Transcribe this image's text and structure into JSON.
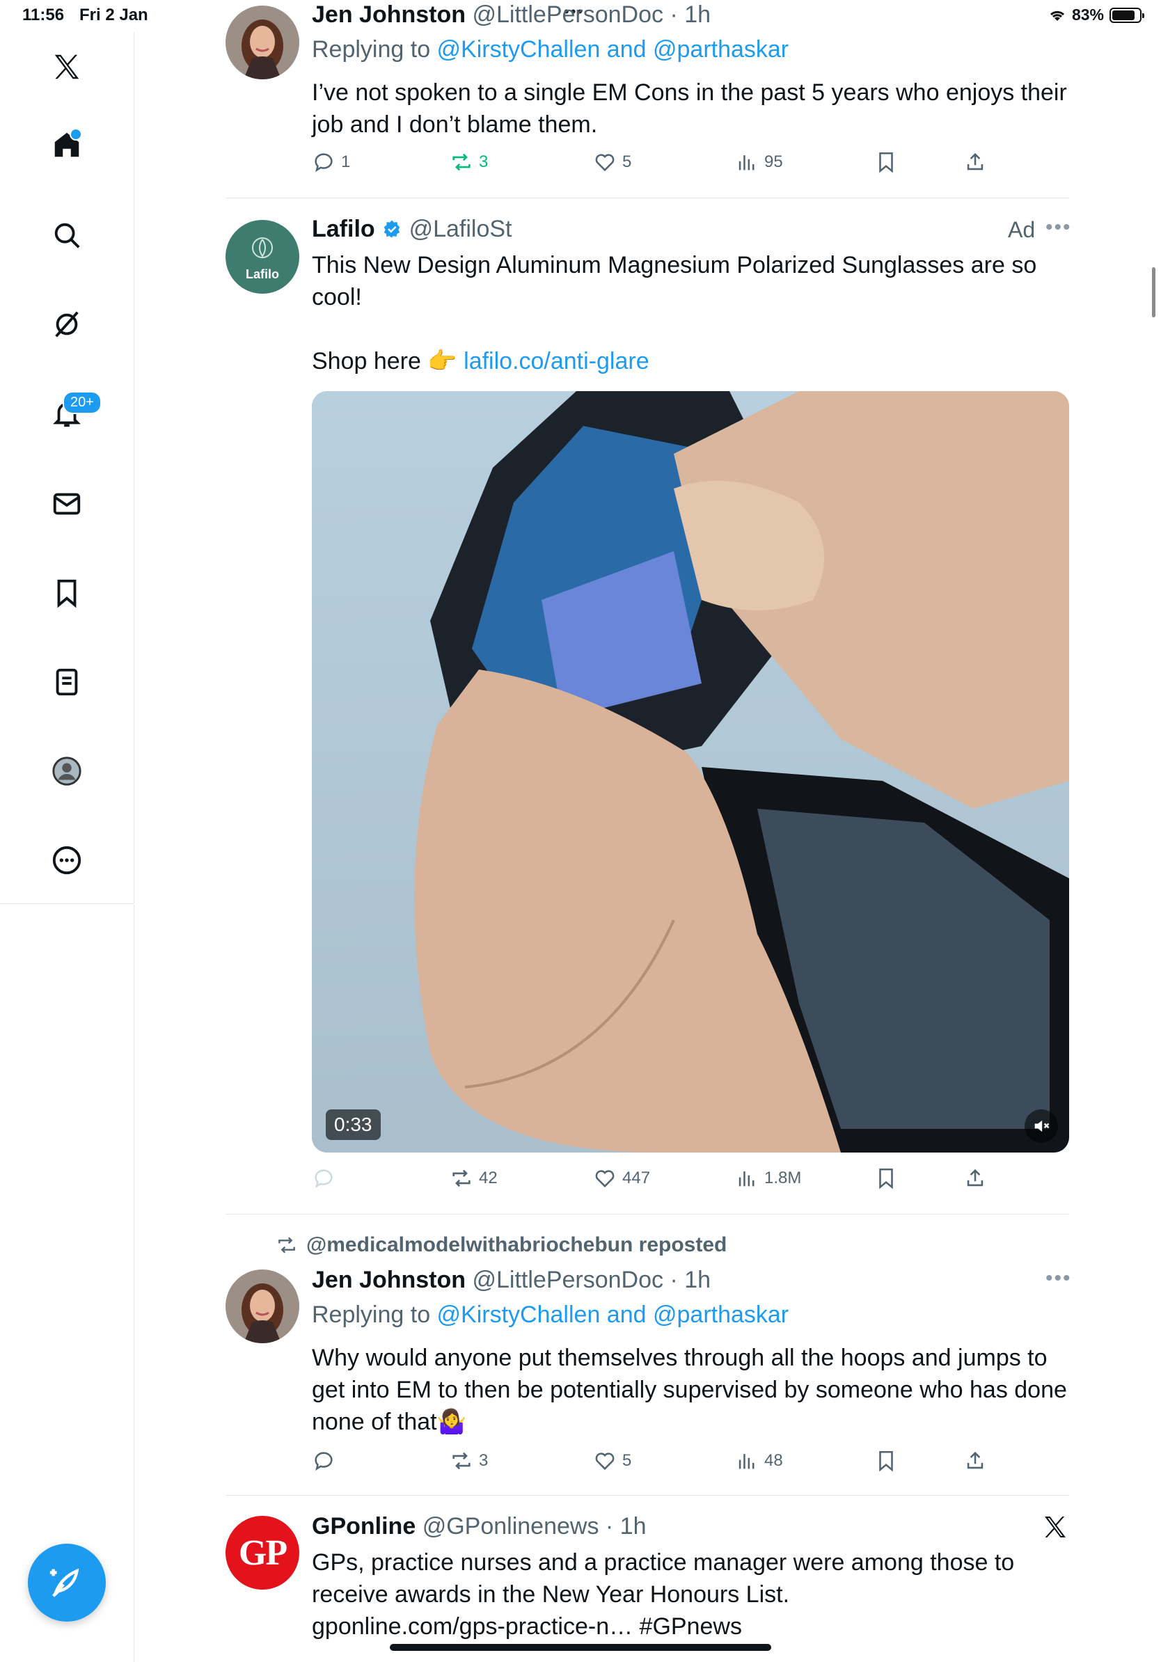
{
  "status_bar": {
    "time": "11:56",
    "date": "Fri 2 Jan",
    "battery": "83%",
    "battery_level": 0.83
  },
  "sidebar": {
    "items": [
      {
        "icon": "x-logo-icon"
      },
      {
        "icon": "home-icon"
      },
      {
        "icon": "search-icon"
      },
      {
        "icon": "grok-icon"
      },
      {
        "icon": "bell-icon",
        "badge": "20+"
      },
      {
        "icon": "mail-icon"
      },
      {
        "icon": "bookmark-icon"
      },
      {
        "icon": "list-icon"
      },
      {
        "icon": "profile-icon"
      },
      {
        "icon": "more-circle-icon"
      }
    ],
    "accent": "#1d9bf0"
  },
  "tweets": [
    {
      "name": "Jen Johnston",
      "handle": "@LittlePersonDoc",
      "time": "· 1h",
      "replying_prefix": "Replying to ",
      "replying_to": "@KirstyChallen and @parthaskar",
      "text": "I’ve not spoken to a single EM Cons in the past 5 years who enjoys their job and I don’t blame them.",
      "replies": "1",
      "reposts": "3",
      "likes": "5",
      "views": "95"
    },
    {
      "name": "Lafilo",
      "handle": "@LafiloSt",
      "ad_label": "Ad",
      "avatar_text": "Lafilo",
      "text_line1": "This New Design Aluminum Magnesium Polarized Sunglasses are so cool!",
      "shop_prefix": "Shop here 👉 ",
      "shop_link": "lafilo.co/anti-glare",
      "video_time": "0:33",
      "reposts": "42",
      "likes": "447",
      "views": "1.8M"
    },
    {
      "repost_by": "@medicalmodelwithabriochebun reposted",
      "name": "Jen Johnston",
      "handle": "@LittlePersonDoc",
      "time": "· 1h",
      "replying_prefix": "Replying to ",
      "replying_to": "@KirstyChallen and @parthaskar",
      "text": "Why would anyone put themselves through all the hoops and jumps to get into EM to then be potentially supervised by someone who has done none of that🤷‍♀️",
      "reposts": "3",
      "likes": "5",
      "views": "48"
    },
    {
      "name": "GPonline",
      "handle": "@GPonlinenews",
      "time": "· 1h",
      "avatar_text": "GP",
      "text": "GPs, practice nurses and a practice manager were among those to receive awards in the New Year Honours List.",
      "link": "gponline.com/gps-practice-n… #GPnews"
    }
  ]
}
